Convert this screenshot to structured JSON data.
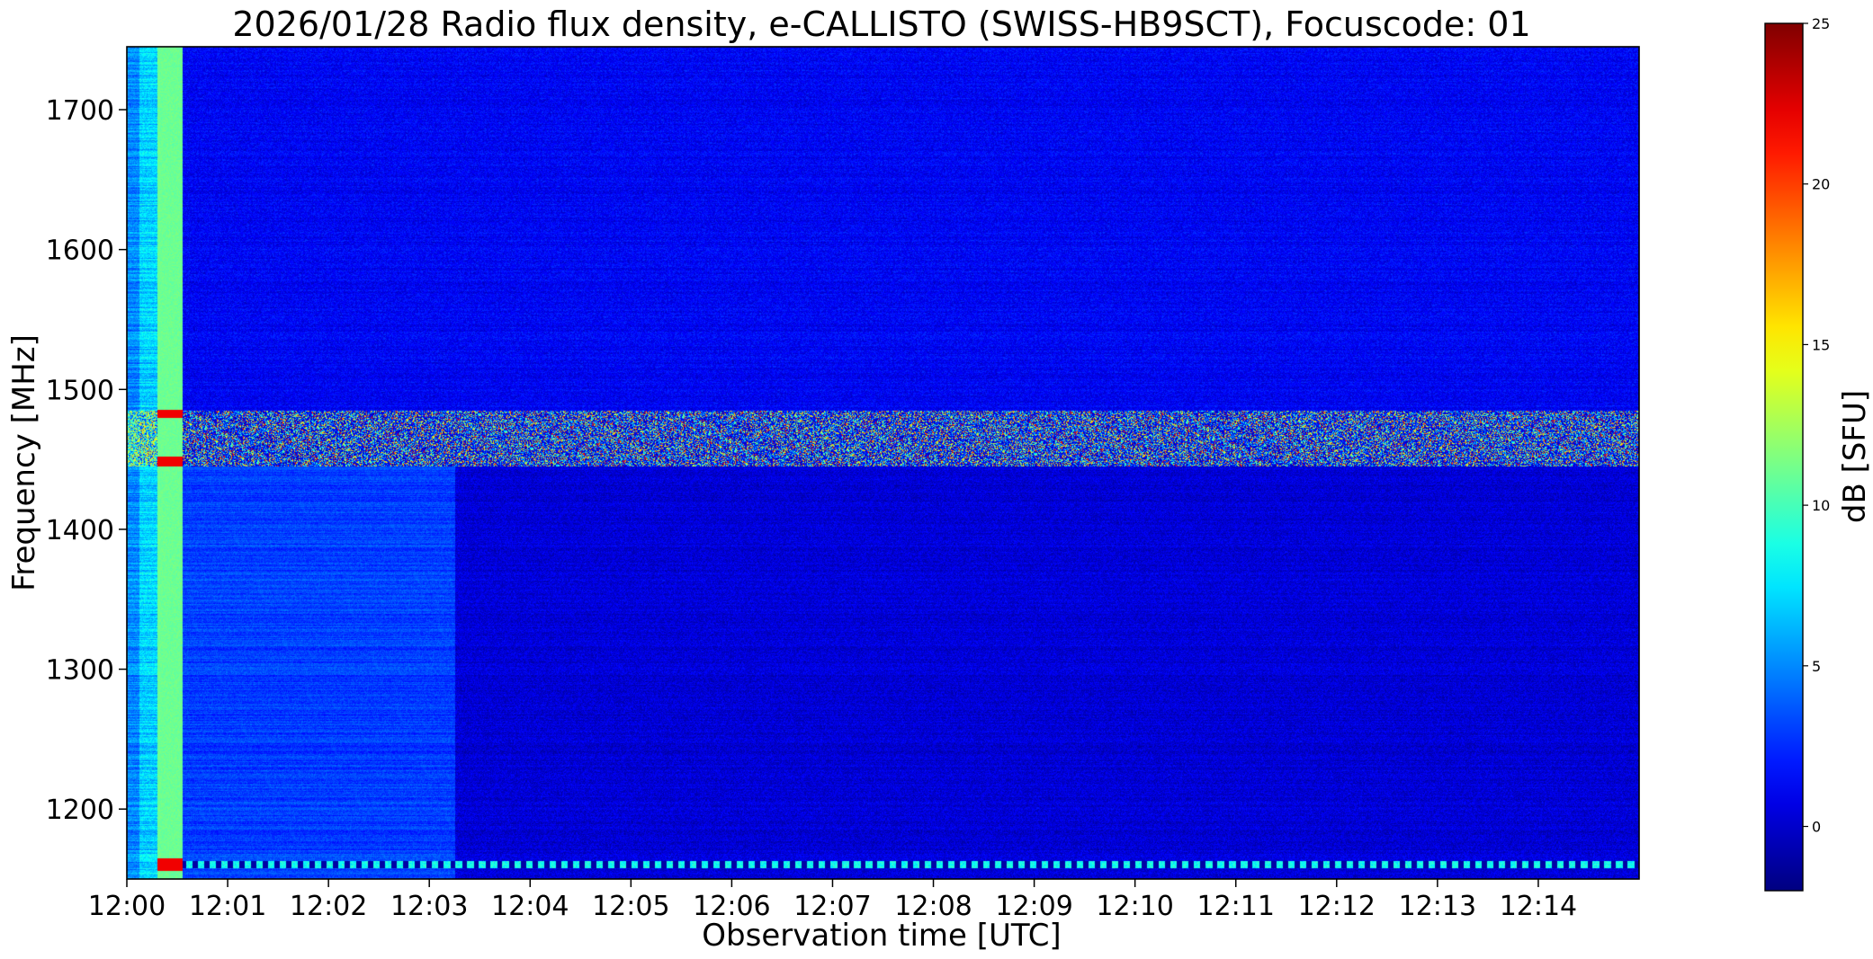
{
  "chart_data": {
    "type": "heatmap",
    "title": "2026/01/28  Radio flux density, e-CALLISTO (SWISS-HB9SCT), Focuscode: 01",
    "xlabel": "Observation time [UTC]",
    "ylabel": "Frequency [MHz]",
    "x_range": [
      "12:00",
      "12:15"
    ],
    "x_ticks": [
      "12:00",
      "12:01",
      "12:02",
      "12:03",
      "12:04",
      "12:05",
      "12:06",
      "12:07",
      "12:08",
      "12:09",
      "12:10",
      "12:11",
      "12:12",
      "12:13",
      "12:14"
    ],
    "y_range_mhz": [
      1150,
      1745
    ],
    "y_ticks": [
      1200,
      1300,
      1400,
      1500,
      1600,
      1700
    ],
    "colorbar": {
      "label": "dB [SFU]",
      "range": [
        -2,
        25
      ],
      "ticks": [
        0,
        5,
        10,
        15,
        20,
        25
      ],
      "colormap": "jet"
    },
    "features": [
      {
        "name": "calibration column",
        "time_min": [
          0.0,
          0.12
        ],
        "level_db": 7
      },
      {
        "name": "noise-source column",
        "time_min": [
          0.3,
          0.55
        ],
        "level_db": 11
      },
      {
        "name": "strong interference band",
        "freq_mhz": [
          1445,
          1485
        ],
        "level_db": 9
      },
      {
        "name": "elevated background before 12:03:15",
        "time_min": [
          0.55,
          3.25
        ],
        "freq_mhz": [
          1150,
          1445
        ],
        "level_db": 3
      },
      {
        "name": "periodic signal near 1160 MHz",
        "freq_mhz": [
          1158,
          1163
        ],
        "level_db": 7
      }
    ]
  }
}
